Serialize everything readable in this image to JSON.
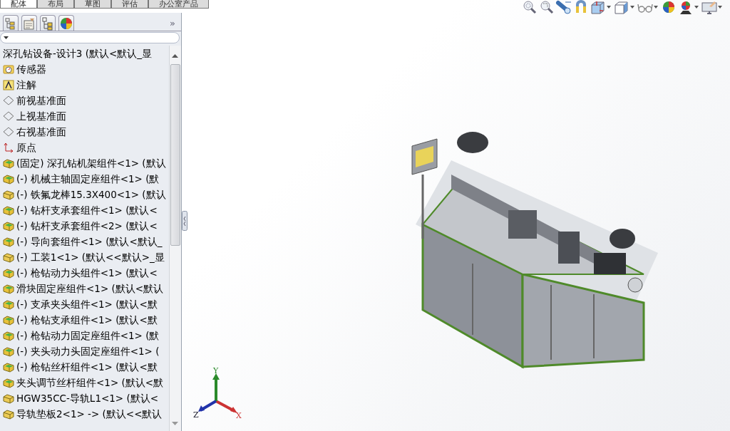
{
  "document_tabs": [
    {
      "label": "配体",
      "selected": true
    },
    {
      "label": "布局",
      "selected": false
    },
    {
      "label": "草图",
      "selected": false
    },
    {
      "label": "评估",
      "selected": false
    },
    {
      "label": "办公室产品",
      "selected": false
    }
  ],
  "panel": {
    "more_button": "»"
  },
  "tree": {
    "root": "深孔钻设备-设计3  (默认<默认_显",
    "items": [
      {
        "kind": "sensor",
        "text": "传感器"
      },
      {
        "kind": "annotation",
        "text": "注解"
      },
      {
        "kind": "plane",
        "text": "前视基准面"
      },
      {
        "kind": "plane",
        "text": "上视基准面"
      },
      {
        "kind": "plane",
        "text": "右视基准面"
      },
      {
        "kind": "origin",
        "text": "原点"
      },
      {
        "kind": "assembly",
        "text": "(固定) 深孔钻机架组件<1> (默认"
      },
      {
        "kind": "assembly",
        "text": "(-) 机械主轴固定座组件<1> (默"
      },
      {
        "kind": "part",
        "text": "(-) 铁氟龙棒15.3X400<1> (默认"
      },
      {
        "kind": "assembly",
        "text": "(-) 钻杆支承套组件<1> (默认<"
      },
      {
        "kind": "assembly",
        "text": "(-) 钻杆支承套组件<2> (默认<"
      },
      {
        "kind": "assembly",
        "text": "(-) 导向套组件<1> (默认<默认_"
      },
      {
        "kind": "part",
        "text": "(-) 工装1<1> (默认<<默认>_显"
      },
      {
        "kind": "assembly",
        "text": "(-) 枪钻动力头组件<1> (默认<"
      },
      {
        "kind": "assembly",
        "text": "滑块固定座组件<1> (默认<默认"
      },
      {
        "kind": "assembly",
        "text": "(-) 支承夹头组件<1> (默认<默"
      },
      {
        "kind": "assembly",
        "text": "(-) 枪钻支承组件<1> (默认<默"
      },
      {
        "kind": "assembly",
        "text": "(-) 枪钻动力固定座组件<1> (默"
      },
      {
        "kind": "assembly",
        "text": "(-) 夹头动力头固定座组件<1> ("
      },
      {
        "kind": "assembly",
        "text": "(-) 枪钻丝杆组件<1> (默认<默"
      },
      {
        "kind": "assembly",
        "text": "夹头调节丝杆组件<1> (默认<默"
      },
      {
        "kind": "part",
        "text": "HGW35CC-导轨L1<1> (默认<"
      },
      {
        "kind": "part",
        "text": "导轨垫板2<1> -> (默认<<默认"
      }
    ]
  },
  "viewport": {
    "triad_labels": [
      "X",
      "Y",
      "Z"
    ]
  }
}
